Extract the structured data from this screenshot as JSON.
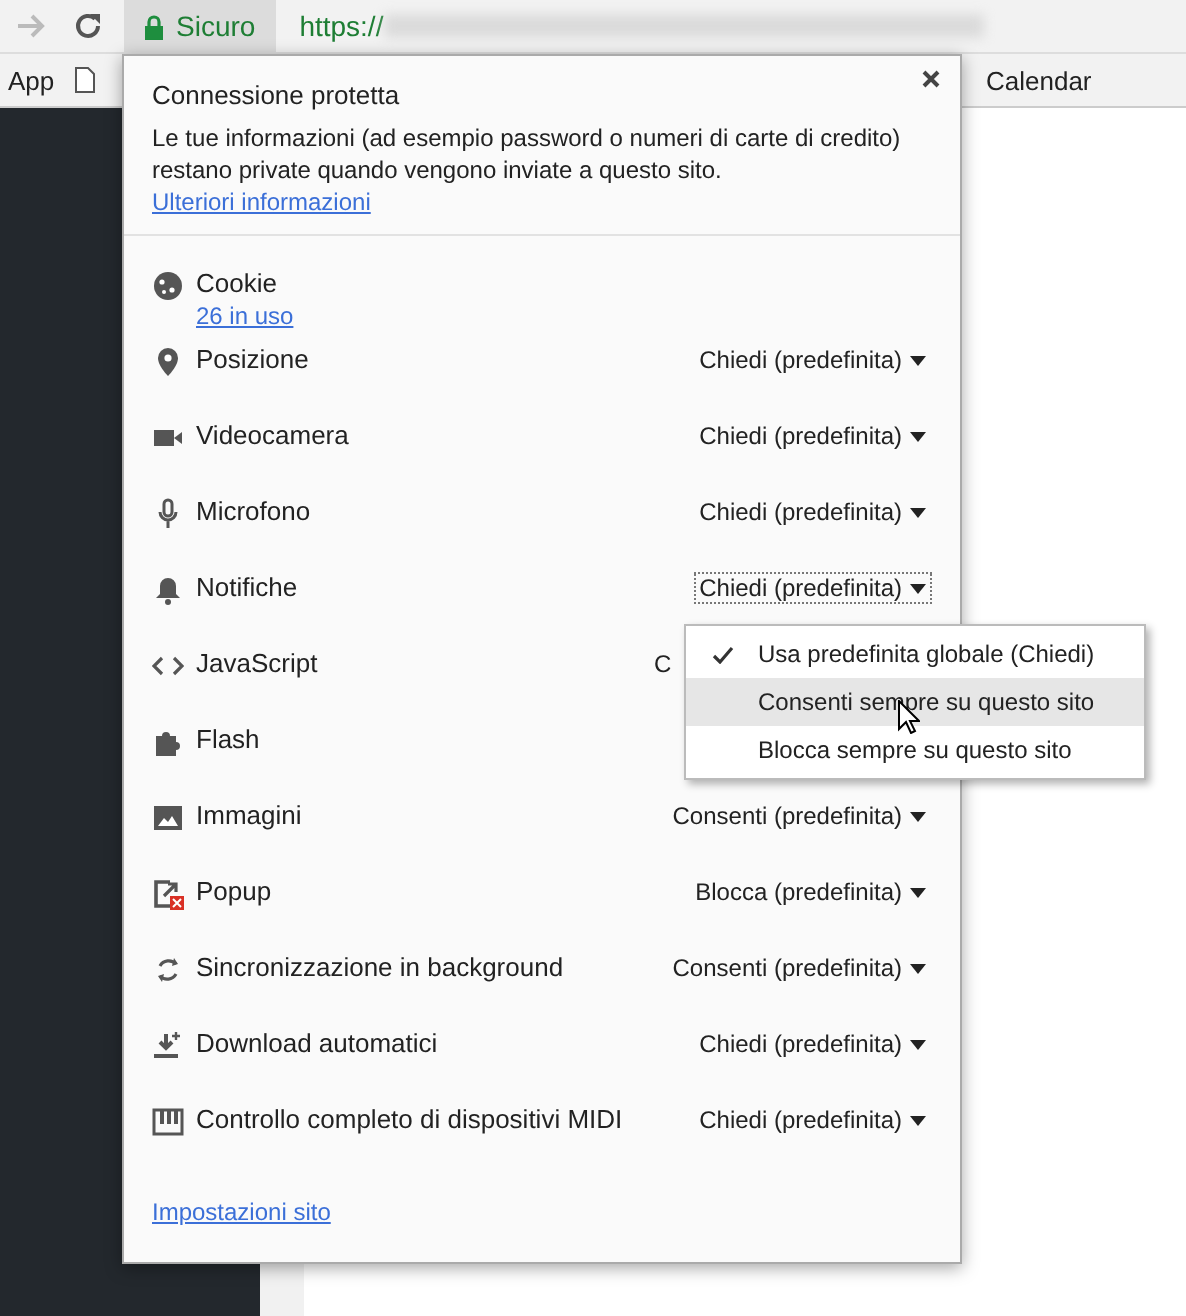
{
  "toolbar": {
    "security_label": "Sicuro",
    "url": "https://"
  },
  "bookmarks": [
    {
      "label": "App"
    },
    {
      "label": "Calendar"
    }
  ],
  "popup": {
    "title": "Connessione protetta",
    "description": "Le tue informazioni (ad esempio password o numeri di carte di credito) restano private quando vengono inviate a questo sito.",
    "more_link": "Ulteriori informazioni",
    "permissions": [
      {
        "label": "Cookie",
        "kind": "detail",
        "detail": "26 in uso"
      },
      {
        "label": "Posizione",
        "kind": "dropdown",
        "value": "Chiedi (predefinita)",
        "focused": false
      },
      {
        "label": "Videocamera",
        "kind": "dropdown",
        "value": "Chiedi (predefinita)",
        "focused": false
      },
      {
        "label": "Microfono",
        "kind": "dropdown",
        "value": "Chiedi (predefinita)",
        "focused": false
      },
      {
        "label": "Notifiche",
        "kind": "dropdown",
        "value": "Chiedi (predefinita)",
        "focused": true
      },
      {
        "label": "JavaScript",
        "kind": "covered",
        "value": "C"
      },
      {
        "label": "Flash",
        "kind": "covered"
      },
      {
        "label": "Immagini",
        "kind": "dropdown",
        "value": "Consenti (predefinita)",
        "focused": false
      },
      {
        "label": "Popup",
        "kind": "dropdown",
        "value": "Blocca (predefinita)",
        "focused": false
      },
      {
        "label": "Sincronizzazione in background",
        "kind": "dropdown",
        "value": "Consenti (predefinita)",
        "focused": false
      },
      {
        "label": "Download automatici",
        "kind": "dropdown",
        "value": "Chiedi (predefinita)",
        "focused": false
      },
      {
        "label": "Controllo completo di dispositivi MIDI",
        "kind": "dropdown",
        "value": "Chiedi (predefinita)",
        "focused": false
      }
    ],
    "footer_link": "Impostazioni sito",
    "menu": [
      {
        "label": "Usa predefinita globale (Chiedi)",
        "checked": true,
        "selected": false
      },
      {
        "label": "Consenti sempre su questo sito",
        "checked": false,
        "selected": true
      },
      {
        "label": "Blocca sempre su questo sito",
        "checked": false,
        "selected": false
      }
    ]
  }
}
